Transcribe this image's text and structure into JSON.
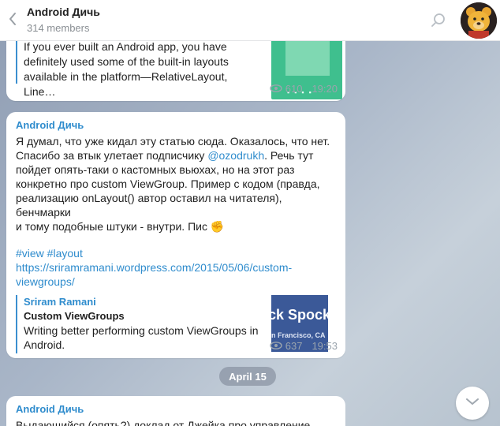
{
  "header": {
    "title": "Android Дичь",
    "subtitle": "314 members"
  },
  "message1": {
    "preview_lines": [
      "If you ever built an Android app, you have",
      "definitely used some of the built-in layouts",
      "available in the platform—RelativeLayout, Line…"
    ],
    "views": "610",
    "time": "19:20"
  },
  "message2": {
    "author": "Android Дичь",
    "text_lines": [
      "Я думал, что уже кидал эту статью сюда. Оказалось, что нет.",
      "Спасибо за втык улетает подписчику ",
      "пойдет опять-таки о кастомных вьюхах, но на этот раз",
      "конкретно про custom ViewGroup. Пример с кодом (правда,",
      "реализацию onLayout() автор оставил на читателя), бенчмарки",
      "и тому подобные штуки - внутри. Пис "
    ],
    "mention": "@ozodrukh",
    "after_mention": ". Речь тут",
    "emoji": "✊",
    "hashtags": "#view #layout",
    "url_line1": "https://sriramramani.wordpress.com/2015/05/06/custom-",
    "url_line2": "viewgroups/",
    "preview": {
      "site": "Sriram Ramani",
      "title": "Custom ViewGroups",
      "desc_line1": "Writing better performing custom ViewGroups in",
      "desc_line2": "Android.",
      "thumb_line1": "ck Spock",
      "thumb_line2": "n Francisco, CA",
      "thumb_color": "#3b5998"
    },
    "views": "637",
    "time": "19:53"
  },
  "date_separator": "April 15",
  "message3": {
    "author": "Android Дичь",
    "text_line": "Выдающийся (опять?) доклад от Джейка про управление"
  },
  "colors": {
    "accent": "#2f8ccd",
    "preview_thumb_green": "#3fbf8e"
  }
}
